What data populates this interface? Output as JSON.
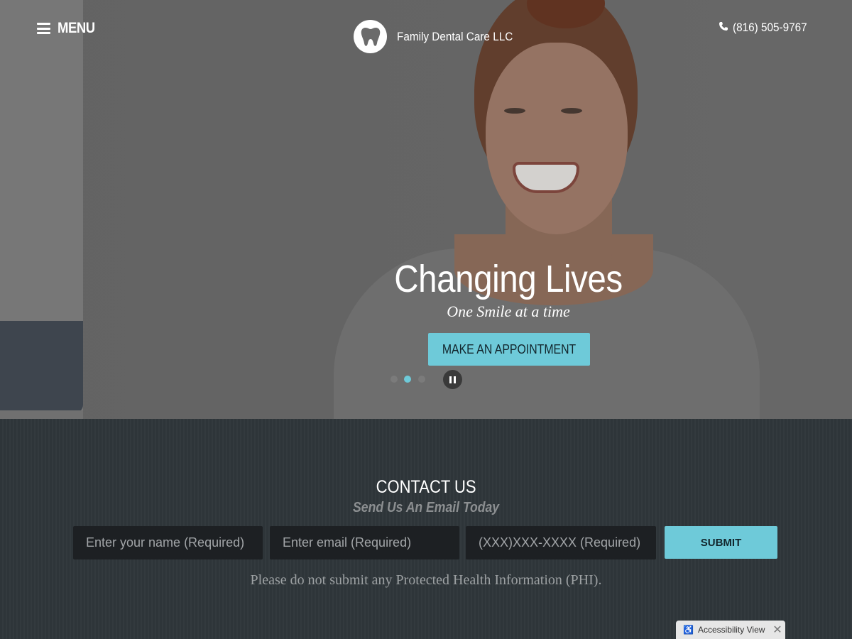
{
  "header": {
    "menu_label": "MENU",
    "menu_icon": "hamburger-icon",
    "logo_icon": "tooth-icon",
    "brand_name": "Family Dental Care LLC",
    "phone_icon": "phone-icon",
    "phone_number": "(816) 505-9767"
  },
  "hero": {
    "title": "Changing Lives",
    "subtitle": "One Smile at a time",
    "cta_label": "MAKE AN APPOINTMENT",
    "slider": {
      "slide_count": 3,
      "active_slide": 2,
      "pause_icon": "pause-icon"
    }
  },
  "contact": {
    "title": "CONTACT US",
    "subtitle": "Send Us An Email Today",
    "fields": {
      "name_placeholder": "Enter your name (Required)",
      "email_placeholder": "Enter email (Required)",
      "phone_placeholder": "(XXX)XXX-XXXX (Required)"
    },
    "submit_label": "SUBMIT",
    "phi_notice": "Please do not submit any Protected Health Information (PHI)."
  },
  "accessibility": {
    "label": "Accessibility View",
    "icon": "wheelchair-icon",
    "close_icon": "close-icon"
  },
  "colors": {
    "accent": "#6ecad9",
    "contact_bg": "#2f363a",
    "field_bg": "#1d2023"
  }
}
